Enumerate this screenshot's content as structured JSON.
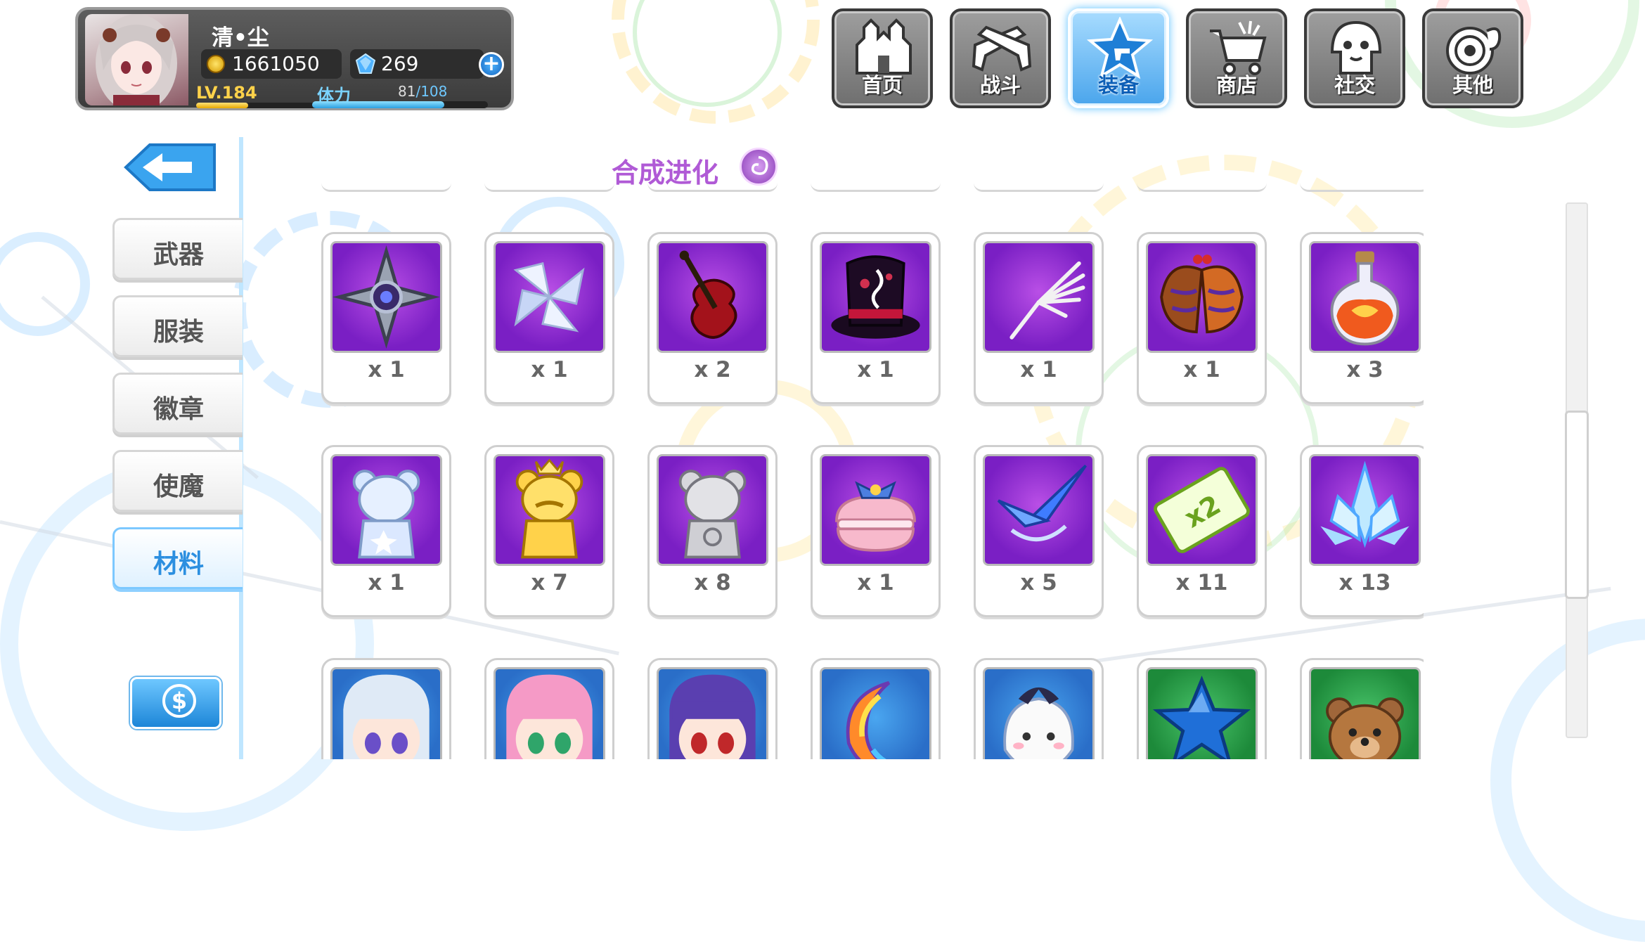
{
  "player": {
    "name": "清•尘",
    "gold": "1661050",
    "gems": "269",
    "level": "LV.184",
    "level_progress": 0.32,
    "stamina_label": "体力",
    "stamina_current": "81",
    "stamina_max": "/108",
    "stamina_fraction": 0.75
  },
  "nav": [
    {
      "label": "首页",
      "icon": "castle-icon",
      "active": false
    },
    {
      "label": "战斗",
      "icon": "crossed-guns-icon",
      "active": false
    },
    {
      "label": "装备",
      "icon": "star-gun-icon",
      "active": true
    },
    {
      "label": "商店",
      "icon": "shopping-cart-icon",
      "active": false
    },
    {
      "label": "社交",
      "icon": "ghost-face-icon",
      "active": false
    },
    {
      "label": "其他",
      "icon": "target-icon",
      "active": false
    }
  ],
  "sidebar": {
    "back_icon": "left-arrow-icon",
    "tabs": [
      {
        "label": "武器",
        "active": false
      },
      {
        "label": "服装",
        "active": false
      },
      {
        "label": "徽章",
        "active": false
      },
      {
        "label": "使魔",
        "active": false
      },
      {
        "label": "材料",
        "active": true
      }
    ],
    "shop_icon": "dollar-coin-icon"
  },
  "section": {
    "title": "合成进化",
    "icon": "swirl-emblem-icon"
  },
  "items": [
    {
      "icon": "shuriken-icon",
      "count": "x 1",
      "frame": "purple"
    },
    {
      "icon": "crystal-pinwheel-icon",
      "count": "x 1",
      "frame": "purple"
    },
    {
      "icon": "violin-icon",
      "count": "x 2",
      "frame": "purple"
    },
    {
      "icon": "top-hat-icon",
      "count": "x 1",
      "frame": "purple"
    },
    {
      "icon": "skeleton-hand-icon",
      "count": "x 1",
      "frame": "purple"
    },
    {
      "icon": "moth-wings-icon",
      "count": "x 1",
      "frame": "purple"
    },
    {
      "icon": "potion-bottle-icon",
      "count": "x 3",
      "frame": "purple"
    },
    {
      "icon": "ice-bear-statue-icon",
      "count": "x 1",
      "frame": "purple"
    },
    {
      "icon": "gold-bear-statue-icon",
      "count": "x 7",
      "frame": "purple"
    },
    {
      "icon": "silver-bear-statue-icon",
      "count": "x 8",
      "frame": "purple"
    },
    {
      "icon": "macaron-icon",
      "count": "x 1",
      "frame": "purple"
    },
    {
      "icon": "blue-blade-icon",
      "count": "x 5",
      "frame": "purple"
    },
    {
      "icon": "x2-ticket-icon",
      "count": "x 11",
      "frame": "purple"
    },
    {
      "icon": "ice-crystal-icon",
      "count": "x 13",
      "frame": "purple"
    },
    {
      "icon": "white-hair-girl-icon",
      "count": "",
      "frame": "blue"
    },
    {
      "icon": "pink-hair-girl-icon",
      "count": "",
      "frame": "blue"
    },
    {
      "icon": "purple-hair-girl-icon",
      "count": "",
      "frame": "blue"
    },
    {
      "icon": "rainbow-moon-icon",
      "count": "",
      "frame": "blue"
    },
    {
      "icon": "white-blob-icon",
      "count": "",
      "frame": "blue"
    },
    {
      "icon": "blue-star-icon",
      "count": "",
      "frame": "green"
    },
    {
      "icon": "teddy-bear-icon",
      "count": "",
      "frame": "green"
    }
  ],
  "scroll_position": 0.6
}
